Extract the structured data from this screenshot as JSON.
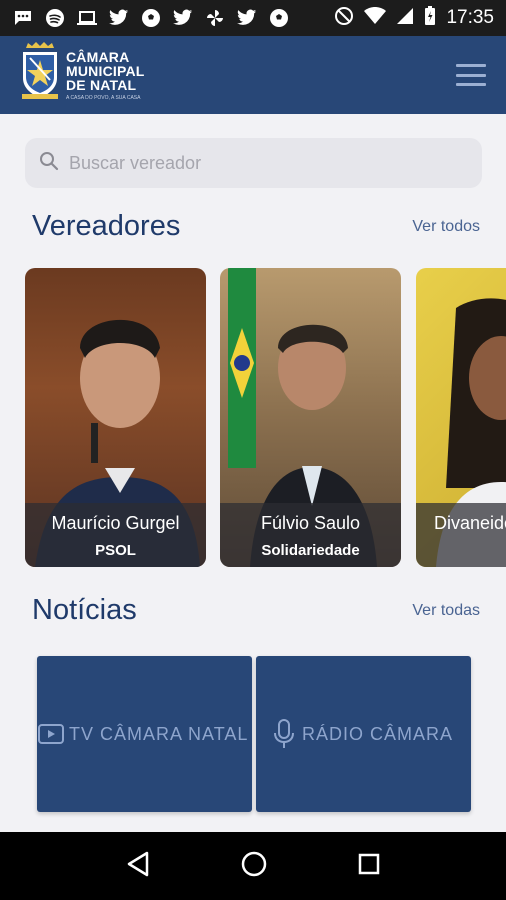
{
  "status_bar": {
    "time": "17:35",
    "left_icons": [
      "message-icon",
      "spotify-icon",
      "laptop-icon",
      "twitter-icon",
      "soccer-ball-icon",
      "twitter-icon",
      "pinwheel-icon",
      "twitter-icon",
      "soccer-ball-icon"
    ],
    "right_icons": [
      "do-not-disturb-icon",
      "wifi-icon",
      "signal-icon",
      "battery-icon"
    ]
  },
  "header": {
    "logo_line1": "CÂMARA",
    "logo_line2": "MUNICIPAL",
    "logo_line3": "DE NATAL",
    "logo_tagline": "A CASA DO POVO, A SUA CASA",
    "menu_icon": "hamburger-menu-icon"
  },
  "search": {
    "placeholder": "Buscar vereador",
    "icon": "search-icon"
  },
  "councilors_section": {
    "title": "Vereadores",
    "link": "Ver todos"
  },
  "councilors": [
    {
      "name": "Maurício Gurgel",
      "party": "PSOL"
    },
    {
      "name": "Fúlvio Saulo",
      "party": "Solidariedade"
    },
    {
      "name": "Divaneide",
      "party": ""
    }
  ],
  "news_section": {
    "title": "Notícias",
    "link": "Ver todas"
  },
  "news_tiles": [
    {
      "label": "TV CÂMARA NATAL",
      "icon": "video-play-icon"
    },
    {
      "label": "RÁDIO CÂMARA",
      "icon": "microphone-icon"
    }
  ],
  "colors": {
    "primary": "#284777",
    "background": "#f2f2f5",
    "title": "#1f3a6a"
  }
}
